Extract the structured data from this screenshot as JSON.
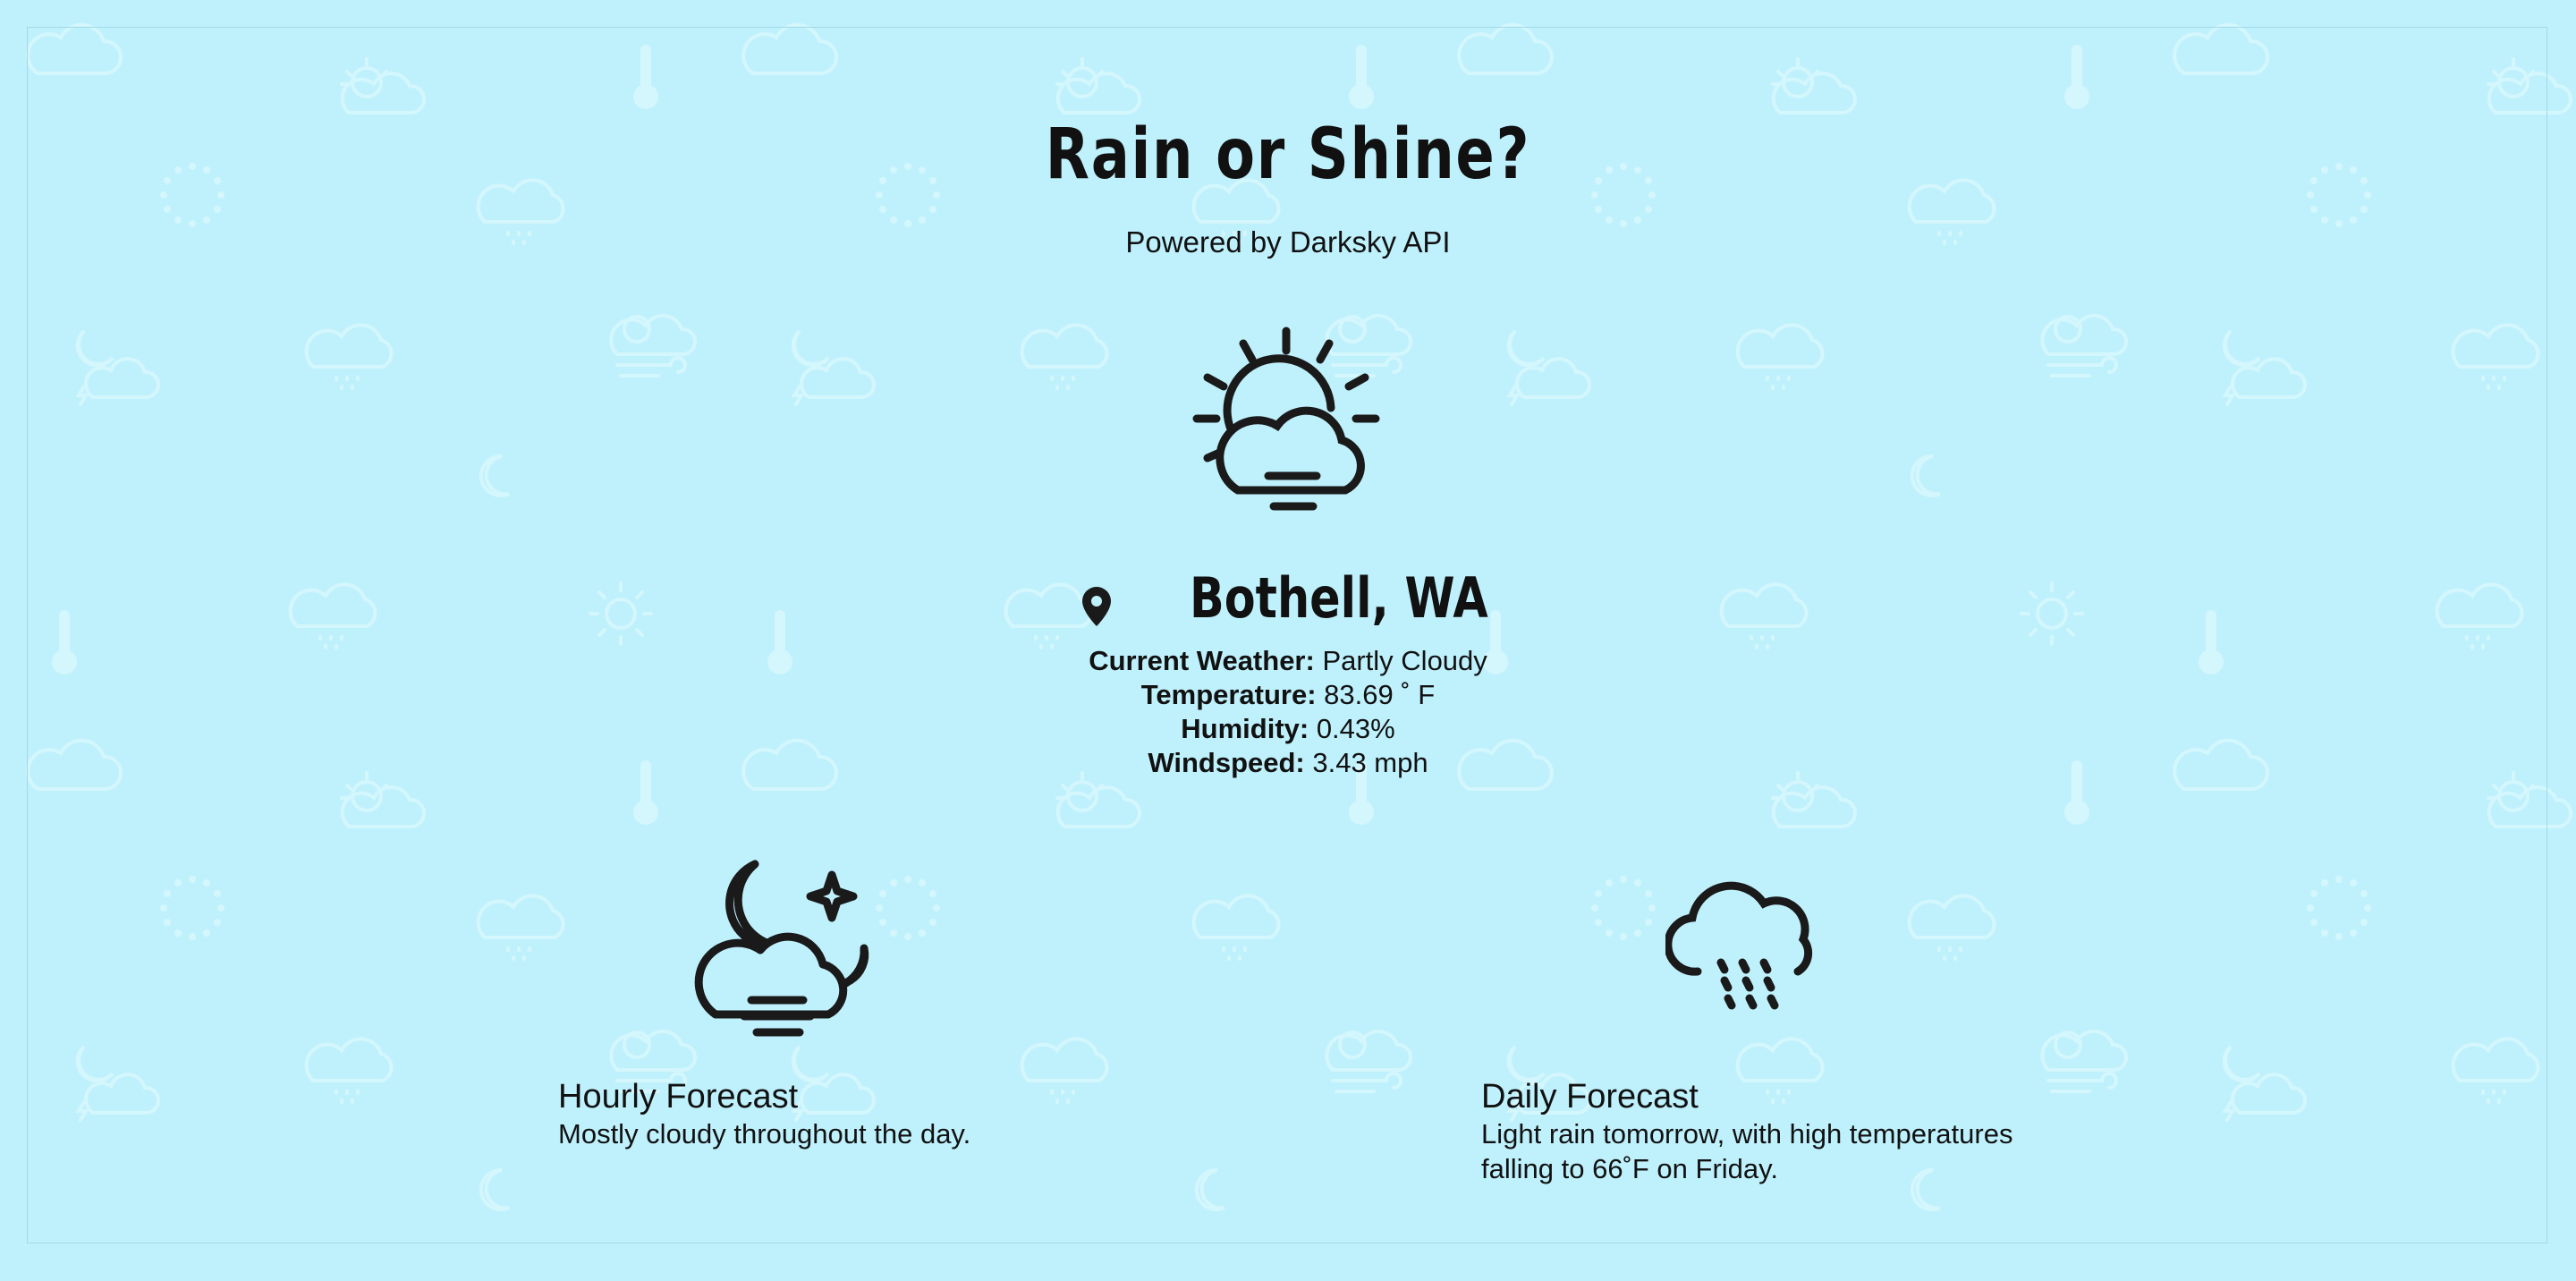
{
  "header": {
    "title": "Rain or Shine?",
    "subtitle": "Powered by Darksky API"
  },
  "current": {
    "icon": "partly-cloudy-fog-icon",
    "location": "Bothell, WA",
    "location_icon": "map-pin-icon",
    "rows": [
      {
        "label": "Current Weather:",
        "value": " Partly Cloudy"
      },
      {
        "label": "Temperature:",
        "value": " 83.69 ˚ F"
      },
      {
        "label": "Humidity:",
        "value": " 0.43%"
      },
      {
        "label": "Windspeed:",
        "value": " 3.43 mph"
      }
    ]
  },
  "hourly": {
    "icon": "night-cloudy-fog-icon",
    "title": "Hourly Forecast",
    "summary": "Mostly cloudy throughout the day."
  },
  "daily": {
    "icon": "rain-cloud-icon",
    "title": "Daily Forecast",
    "summary": "Light rain tomorrow, with high temperatures falling to 66˚F on Friday."
  },
  "colors": {
    "background": "#bff1fd",
    "pattern": "#d4f6fd",
    "text": "#111111"
  }
}
